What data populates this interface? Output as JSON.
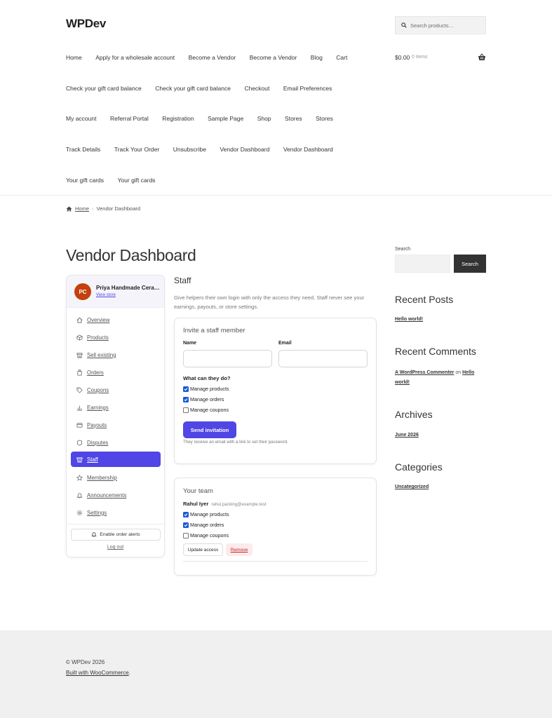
{
  "site": {
    "title": "WPDev"
  },
  "header_search": {
    "placeholder": "Search products…"
  },
  "nav": {
    "row1": [
      "Home",
      "Apply for a wholesale account",
      "Become a Vendor",
      "Become a Vendor",
      "Blog",
      "Cart"
    ],
    "row2": [
      "Check your gift card balance",
      "Check your gift card balance",
      "Checkout",
      "Email Preferences"
    ],
    "row3": [
      "My account",
      "Referral Portal",
      "Registration",
      "Sample Page",
      "Shop",
      "Stores",
      "Stores"
    ],
    "row4": [
      "Track Details",
      "Track Your Order",
      "Unsubscribe",
      "Vendor Dashboard",
      "Vendor Dashboard"
    ],
    "row5": [
      "Your gift cards",
      "Your gift cards"
    ]
  },
  "cart": {
    "amount": "$0.00",
    "items": "0 items"
  },
  "breadcrumb": {
    "home": "Home",
    "current": "Vendor Dashboard"
  },
  "page": {
    "title": "Vendor Dashboard"
  },
  "vendor": {
    "initials": "PC",
    "store_name": "Priya Handmade Ceramics",
    "view_store": "View store",
    "menu": [
      {
        "label": "Overview",
        "icon": "home-icon",
        "active": false
      },
      {
        "label": "Products",
        "icon": "box-icon",
        "active": false
      },
      {
        "label": "Sell existing",
        "icon": "store-icon",
        "active": false
      },
      {
        "label": "Orders",
        "icon": "bag-icon",
        "active": false
      },
      {
        "label": "Coupons",
        "icon": "tag-icon",
        "active": false
      },
      {
        "label": "Earnings",
        "icon": "bar-chart-icon",
        "active": false
      },
      {
        "label": "Payouts",
        "icon": "card-icon",
        "active": false
      },
      {
        "label": "Disputes",
        "icon": "shield-icon",
        "active": false
      },
      {
        "label": "Staff",
        "icon": "store-icon",
        "active": true
      },
      {
        "label": "Membership",
        "icon": "star-icon",
        "active": false
      },
      {
        "label": "Announcements",
        "icon": "bell-icon",
        "active": false
      },
      {
        "label": "Settings",
        "icon": "gear-icon",
        "active": false
      }
    ],
    "alerts_button": "Enable order alerts",
    "logout": "Log out"
  },
  "staff": {
    "title": "Staff",
    "description": "Give helpers their own login with only the access they need. Staff never see your earnings, payouts, or store settings.",
    "invite": {
      "title": "Invite a staff member",
      "name_label": "Name",
      "email_label": "Email",
      "permissions_heading": "What can they do?",
      "permissions": [
        {
          "label": "Manage products",
          "checked": true
        },
        {
          "label": "Manage orders",
          "checked": true
        },
        {
          "label": "Manage coupons",
          "checked": false
        }
      ],
      "send_button": "Send invitation",
      "note": "They receive an email with a link to set their password."
    },
    "team": {
      "title": "Your team",
      "member_name": "Rahul Iyer",
      "member_email": "rahul.packing@example.test",
      "permissions": [
        {
          "label": "Manage products",
          "checked": true
        },
        {
          "label": "Manage orders",
          "checked": true
        },
        {
          "label": "Manage coupons",
          "checked": false
        }
      ],
      "update_button": "Update access",
      "remove_button": "Remove"
    }
  },
  "widgets": {
    "search_label": "Search",
    "search_button": "Search",
    "recent_posts_title": "Recent Posts",
    "recent_post": "Hello world!",
    "recent_comments_title": "Recent Comments",
    "comment_author": "A WordPress Commenter",
    "comment_on": "on",
    "comment_post": "Hello world!",
    "archives_title": "Archives",
    "archive": "June 2026",
    "categories_title": "Categories",
    "category": "Uncategorized"
  },
  "footer": {
    "copyright": "© WPDev 2026",
    "built_with": "Built with WooCommerce",
    "period": "."
  },
  "colors": {
    "accent": "#4f46e5",
    "avatar": "#c2410c",
    "footer_bg": "#f0f0f0"
  }
}
